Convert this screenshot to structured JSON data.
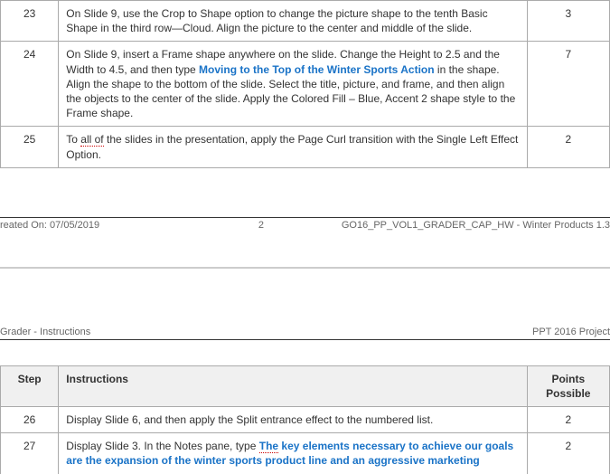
{
  "footer": {
    "created": "reated On: 07/05/2019",
    "pagenum": "2",
    "docid": "GO16_PP_VOL1_GRADER_CAP_HW - Winter Products 1.3"
  },
  "header2": {
    "left": "Grader - Instructions",
    "right": "PPT 2016 Project"
  },
  "columns": {
    "step": "Step",
    "instructions": "Instructions",
    "points": "Points Possible"
  },
  "rows_top": [
    {
      "step": "23",
      "points": "3",
      "text_before": "On Slide 9, use the Crop to Shape option to change the picture shape to the tenth Basic Shape in the third row—Cloud. Align the picture to the center and middle of the slide.",
      "highlight": "",
      "text_after": ""
    },
    {
      "step": "24",
      "points": "7",
      "text_before": "On Slide 9, insert a Frame shape anywhere on the slide. Change the Height to 2.5 and the Width to 4.5, and then type ",
      "highlight": "Moving to the Top of the Winter Sports Action",
      "text_after": " in the shape. Align the shape to the bottom of the slide. Select the title, picture, and frame, and then align the objects to the center of the slide. Apply the Colored Fill – Blue, Accent 2 shape style to the Frame shape."
    },
    {
      "step": "25",
      "points": "2",
      "text_before_sq": "To ",
      "sq": "all of",
      "text_after_sq": " the slides in the presentation, apply the Page Curl transition with the Single Left Effect Option."
    }
  ],
  "rows_bottom": [
    {
      "step": "26",
      "points": "2",
      "text_before": "Display Slide 6, and then apply the Split entrance effect to the numbered list.",
      "highlight": "",
      "text_after": ""
    },
    {
      "step": "27",
      "points": "2",
      "text_before": "Display Slide 3. In the Notes pane, type ",
      "hl_sq": "The",
      "highlight": " key elements necessary to achieve our goals are the expansion of the winter sports product line and an aggressive marketing",
      "text_after": ""
    }
  ]
}
